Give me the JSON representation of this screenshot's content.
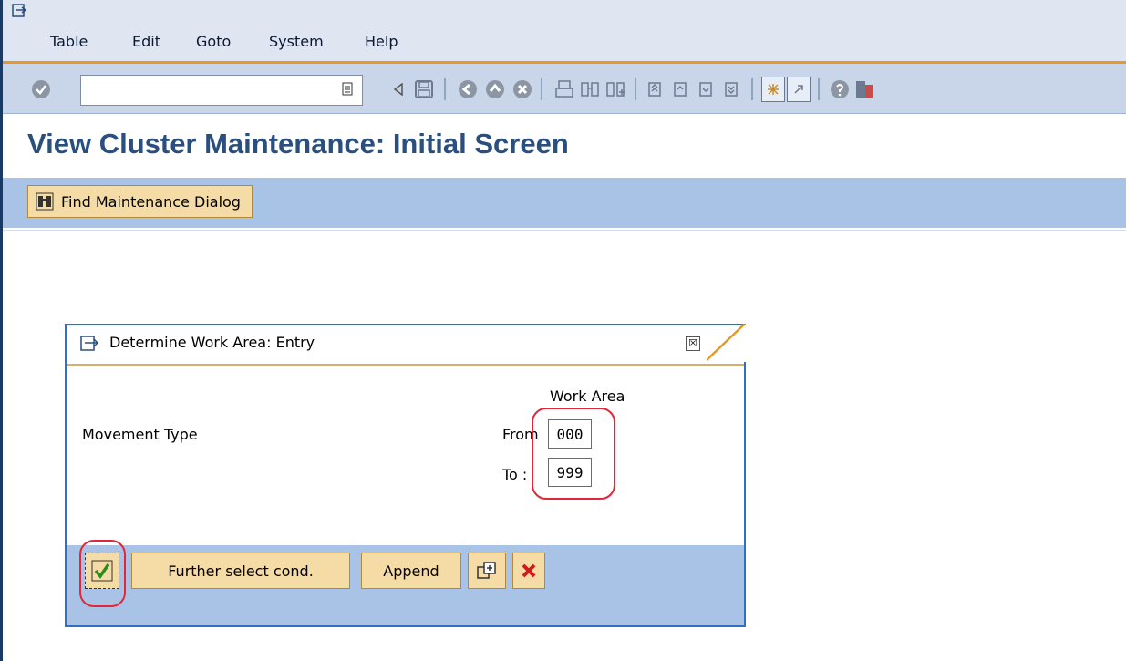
{
  "menu": {
    "table": "Table",
    "edit": "Edit",
    "goto": "Goto",
    "system": "System",
    "help": "Help"
  },
  "toolbar": {
    "command_value": ""
  },
  "screen": {
    "title": "View Cluster Maintenance: Initial Screen",
    "find_button": "Find Maintenance Dialog"
  },
  "dialog": {
    "title": "Determine Work Area: Entry",
    "close_glyph": "☒",
    "work_area_header": "Work Area",
    "row_label": "Movement Type",
    "from_label": "From",
    "to_label": "To :",
    "from_value": "000",
    "to_value": "999",
    "buttons": {
      "further": "Further select cond.",
      "append": "Append"
    }
  },
  "colors": {
    "title": "#2a4f7e",
    "highlight": "#e0283a",
    "button_bg": "#f5dca6"
  }
}
